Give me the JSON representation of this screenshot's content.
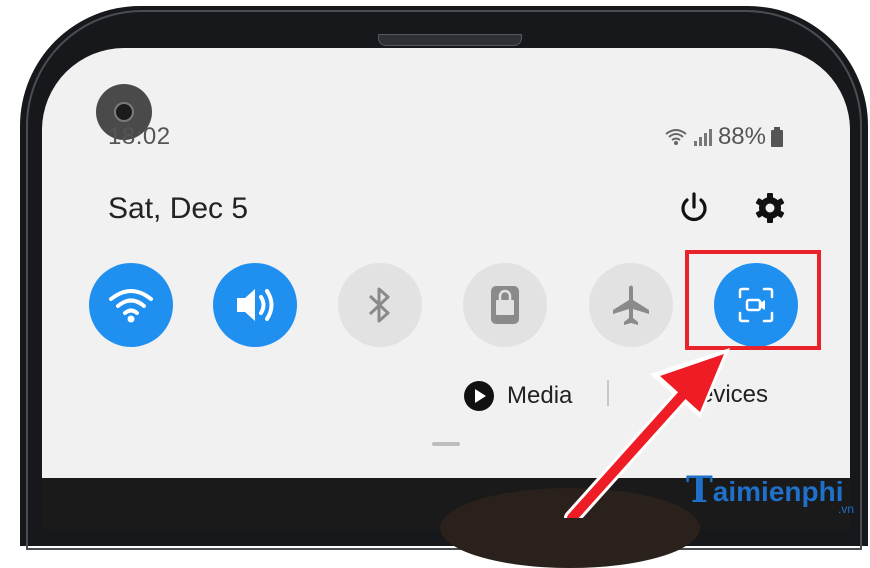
{
  "status_bar": {
    "time": "18:02",
    "battery": "88%"
  },
  "header": {
    "date": "Sat, Dec 5"
  },
  "toggles": [
    {
      "name": "wifi",
      "state": "on"
    },
    {
      "name": "sound",
      "state": "on"
    },
    {
      "name": "bluetooth",
      "state": "off"
    },
    {
      "name": "portrait",
      "state": "off"
    },
    {
      "name": "airplane",
      "state": "off"
    },
    {
      "name": "screen-recorder",
      "state": "on"
    }
  ],
  "media_row": {
    "media_label": "Media",
    "devices_label": "evices"
  },
  "watermark": {
    "brand_text": "aimienphi",
    "domain": ".vn"
  },
  "colors": {
    "accent": "#1f8ff0",
    "highlight": "#e8232a",
    "panel": "#f1f1f1"
  }
}
